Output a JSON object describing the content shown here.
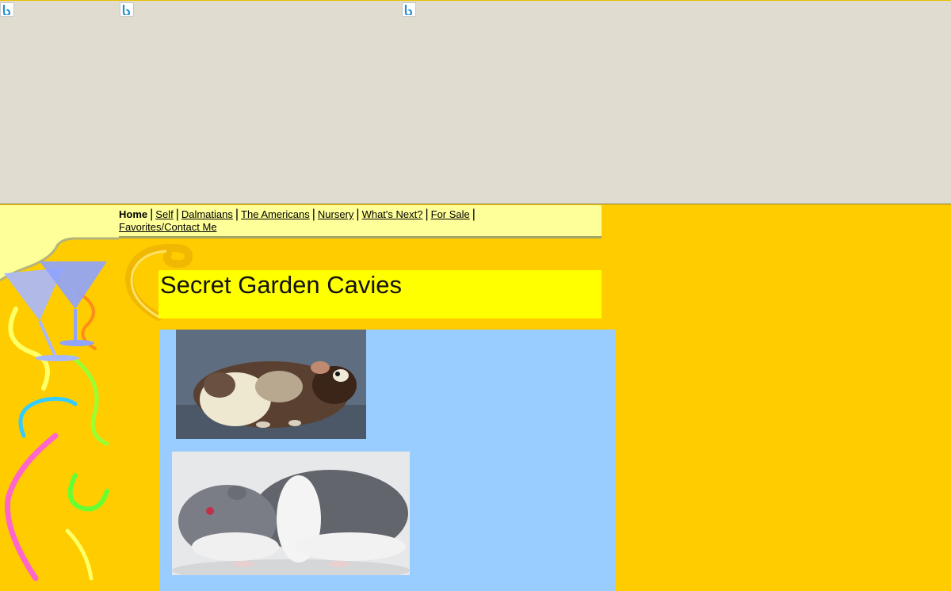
{
  "ad_banner": {
    "icons": [
      "ad-choice-icon",
      "ad-choice-icon",
      "ad-choice-icon"
    ]
  },
  "nav": {
    "items": [
      {
        "label": "Home",
        "current": true
      },
      {
        "label": "Self"
      },
      {
        "label": "Dalmatians"
      },
      {
        "label": "The Americans"
      },
      {
        "label": "Nursery"
      },
      {
        "label": "What's Next?"
      },
      {
        "label": "For Sale"
      },
      {
        "label": "Favorites/Contact Me"
      }
    ],
    "separator": "|"
  },
  "header": {
    "title": "Secret Garden Cavies"
  },
  "photos": [
    {
      "icon": "tortoiseshell-guinea-pig-photo"
    },
    {
      "icon": "gray-white-guinea-pig-photo"
    }
  ],
  "colors": {
    "page_background": "#ffcc00",
    "nav_background": "#ffff99",
    "title_background": "#ffff00",
    "content_background": "#99ccff",
    "ad_background": "#e0dcd0"
  }
}
